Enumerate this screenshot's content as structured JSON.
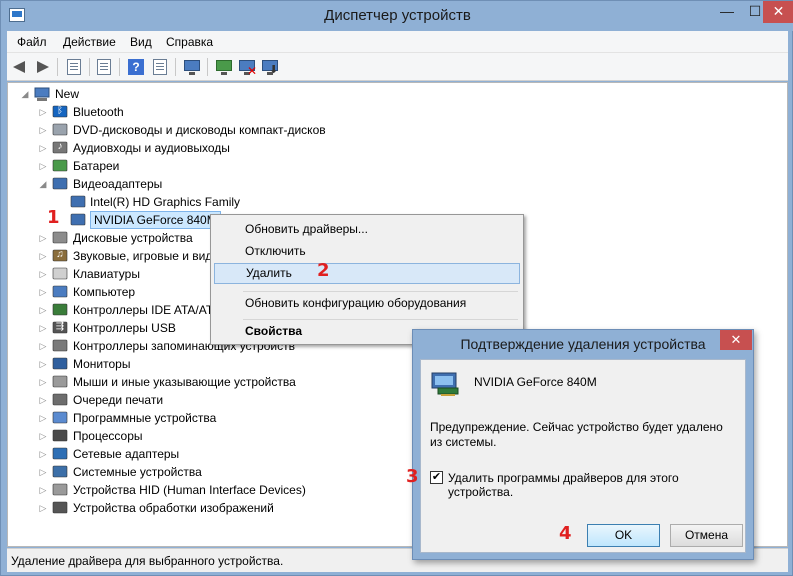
{
  "window": {
    "title": "Диспетчер устройств"
  },
  "menu": [
    "Файл",
    "Действие",
    "Вид",
    "Справка"
  ],
  "tree": {
    "root": "New",
    "rows": [
      {
        "label": "Bluetooth",
        "icon": "bluetooth-icon"
      },
      {
        "label": "DVD-дисководы и дисководы компакт-дисков",
        "icon": "dvd-drive-icon"
      },
      {
        "label": "Аудиовходы и аудиовыходы",
        "icon": "audio-icon"
      },
      {
        "label": "Батареи",
        "icon": "battery-icon"
      },
      {
        "label": "Видеоадаптеры",
        "icon": "display-adapter-icon",
        "expanded": true
      },
      {
        "label": "Intel(R) HD Graphics Family",
        "icon": "display-adapter-icon",
        "child": true
      },
      {
        "label": "NVIDIA GeForce 840M",
        "icon": "display-adapter-icon",
        "child": true,
        "selected": true
      },
      {
        "label": "Дисковые устройства",
        "icon": "disk-drive-icon"
      },
      {
        "label": "Звуковые, игровые и видеоустройства",
        "icon": "sound-icon"
      },
      {
        "label": "Клавиатуры",
        "icon": "keyboard-icon"
      },
      {
        "label": "Компьютер",
        "icon": "computer-icon"
      },
      {
        "label": "Контроллеры IDE ATA/ATAPI",
        "icon": "ide-controller-icon"
      },
      {
        "label": "Контроллеры USB",
        "icon": "usb-icon"
      },
      {
        "label": "Контроллеры запоминающих устройств",
        "icon": "storage-controller-icon"
      },
      {
        "label": "Мониторы",
        "icon": "monitor-icon"
      },
      {
        "label": "Мыши и иные указывающие устройства",
        "icon": "mouse-icon"
      },
      {
        "label": "Очереди печати",
        "icon": "printer-icon"
      },
      {
        "label": "Программные устройства",
        "icon": "software-device-icon"
      },
      {
        "label": "Процессоры",
        "icon": "processor-icon"
      },
      {
        "label": "Сетевые адаптеры",
        "icon": "network-adapter-icon"
      },
      {
        "label": "Системные устройства",
        "icon": "system-device-icon"
      },
      {
        "label": "Устройства HID (Human Interface Devices)",
        "icon": "hid-icon"
      },
      {
        "label": "Устройства обработки изображений",
        "icon": "imaging-device-icon"
      }
    ]
  },
  "context_menu": {
    "update": "Обновить драйверы...",
    "disable": "Отключить",
    "uninstall": "Удалить",
    "scan": "Обновить конфигурацию оборудования",
    "properties": "Свойства"
  },
  "dialog": {
    "title": "Подтверждение удаления устройства",
    "device_name": "NVIDIA GeForce 840M",
    "warning": "Предупреждение. Сейчас устройство будет удалено из системы.",
    "checkbox_label": "Удалить программы драйверов для этого устройства.",
    "checkbox_mark": "✔",
    "ok": "OK",
    "cancel": "Отмена"
  },
  "status": "Удаление драйвера для выбранного устройства.",
  "steps": [
    "1",
    "2",
    "3",
    "4"
  ],
  "colors": {
    "accent": "#3399ff",
    "step": "#e02020",
    "close": "#c75050",
    "selection": "#cce8ff"
  }
}
